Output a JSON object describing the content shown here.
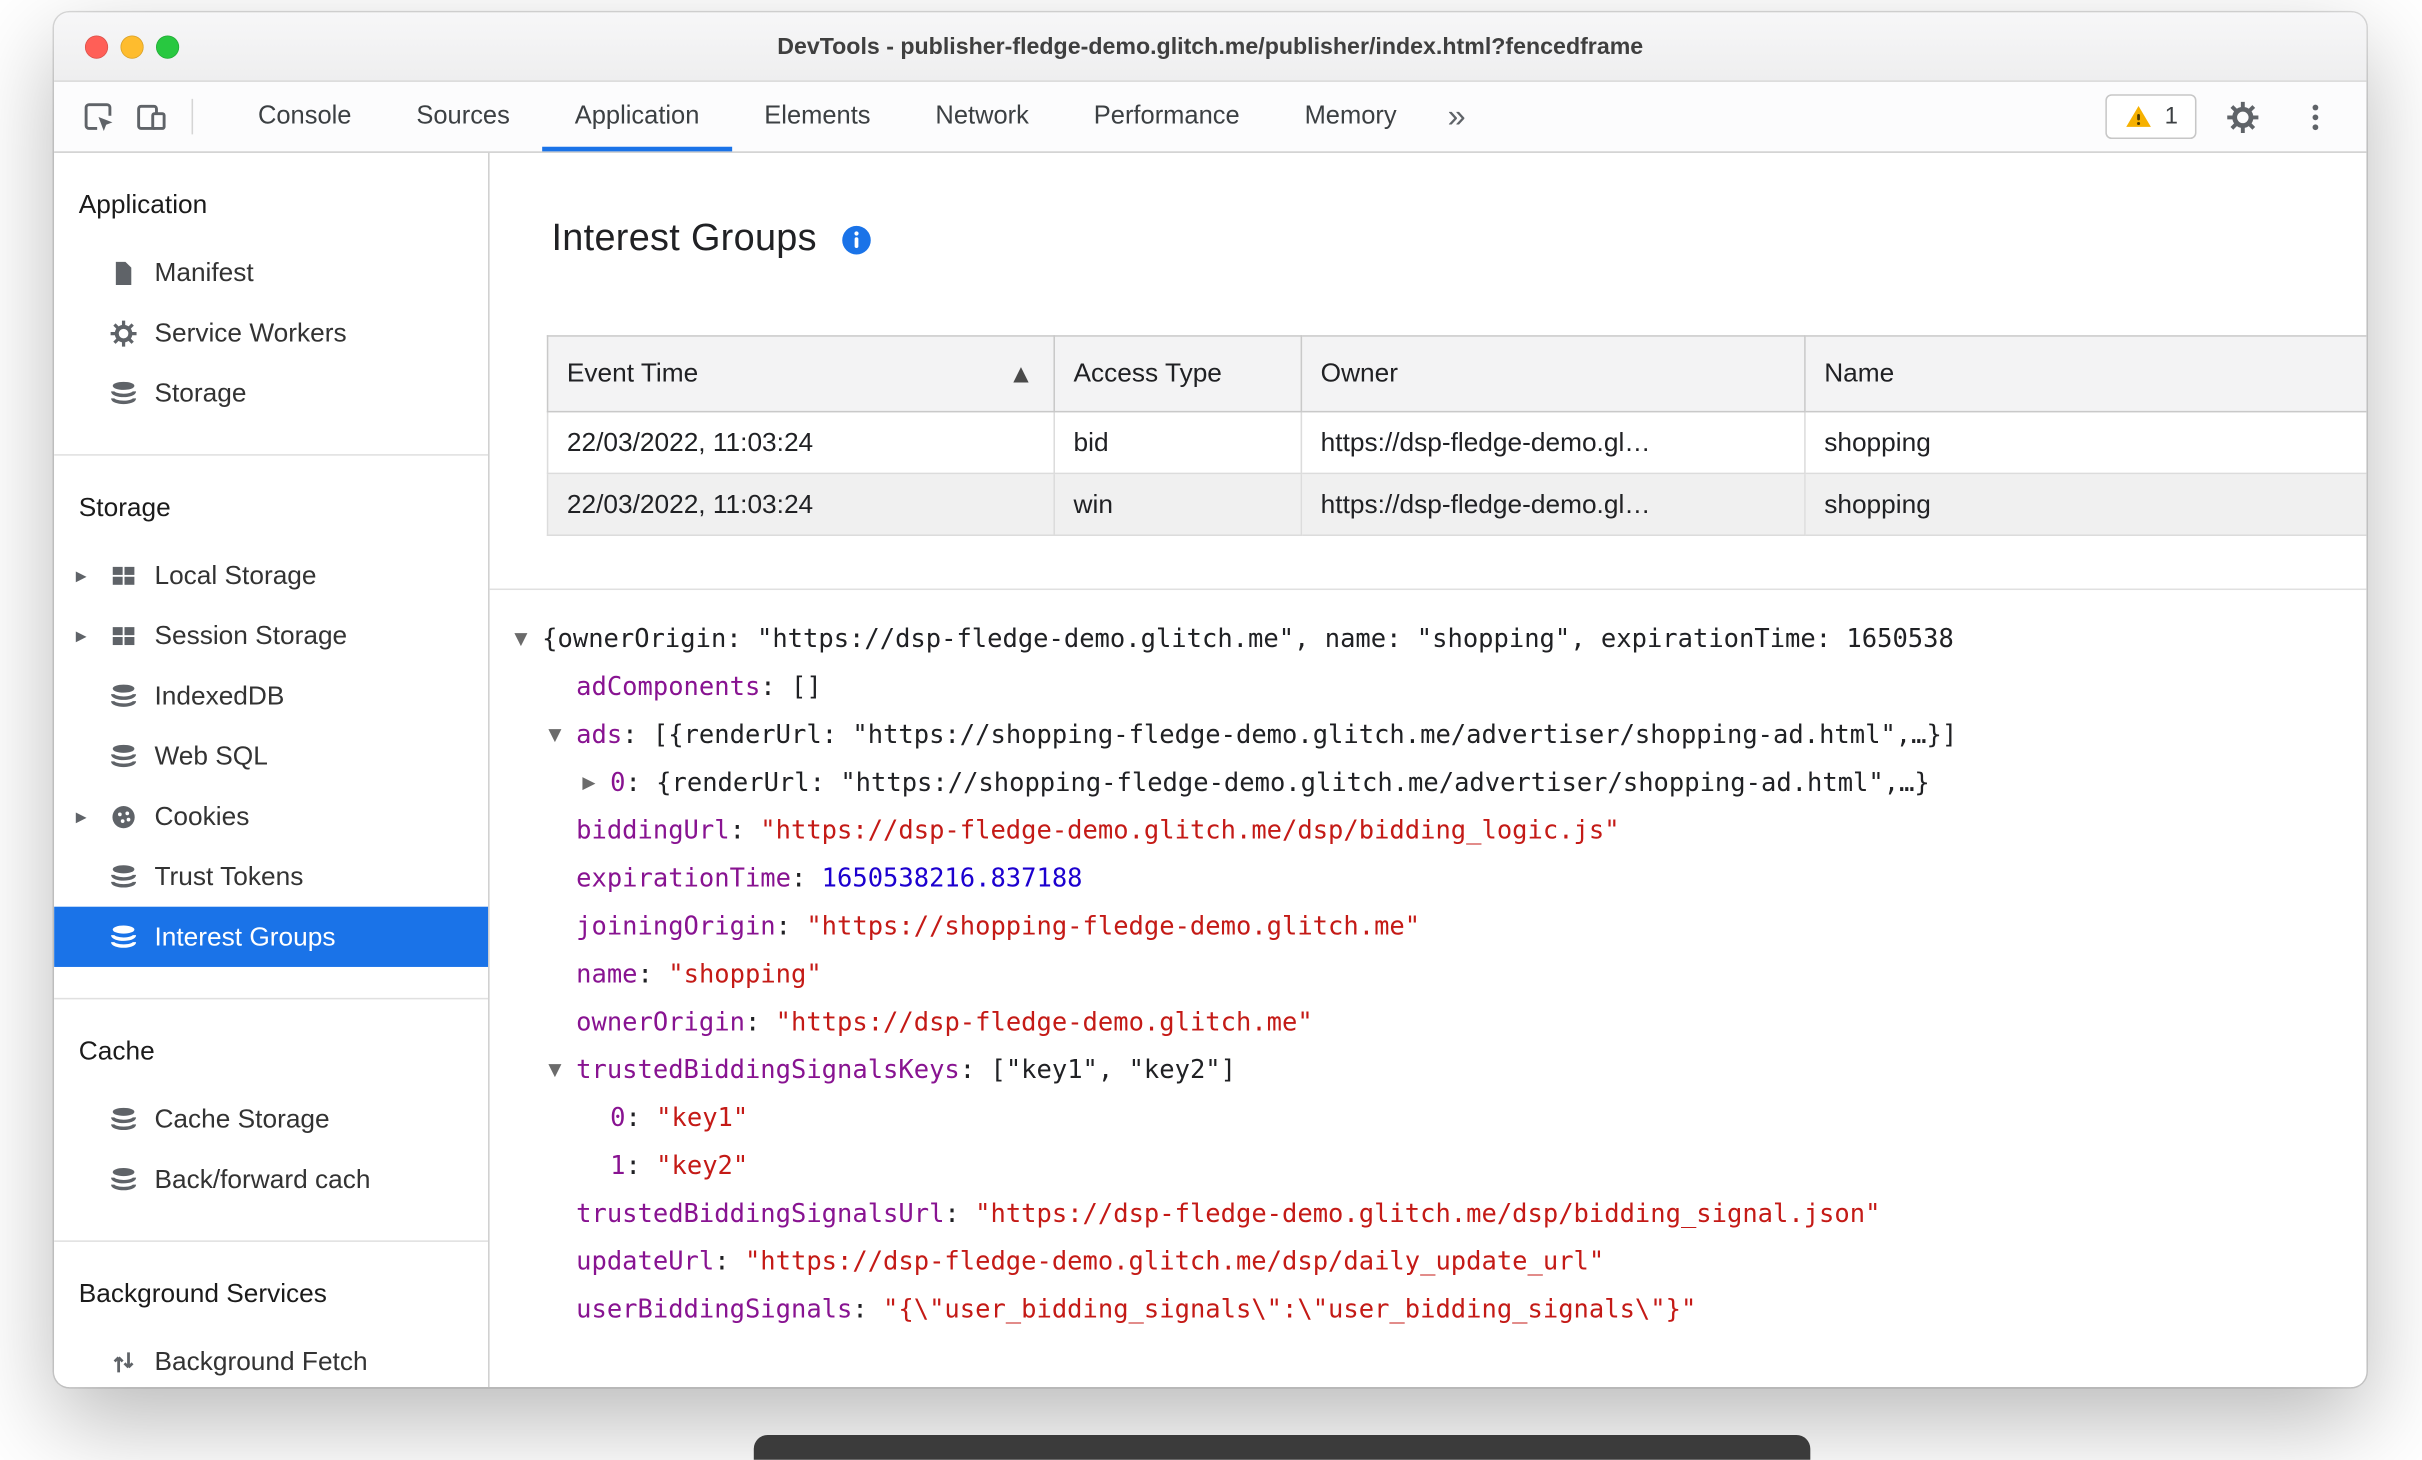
{
  "window": {
    "title": "DevTools - publisher-fledge-demo.glitch.me/publisher/index.html?fencedframe"
  },
  "toolbar": {
    "tabs": [
      {
        "label": "Console",
        "active": false
      },
      {
        "label": "Sources",
        "active": false
      },
      {
        "label": "Application",
        "active": true
      },
      {
        "label": "Elements",
        "active": false
      },
      {
        "label": "Network",
        "active": false
      },
      {
        "label": "Performance",
        "active": false
      },
      {
        "label": "Memory",
        "active": false
      }
    ],
    "more_tabs_glyph": "»",
    "issues_count": "1",
    "icons": {
      "inspect": "inspect-icon",
      "device_toolbar": "device-toolbar-icon",
      "issues": "warning-icon",
      "settings": "gear-icon",
      "more_options": "kebab-menu-icon"
    }
  },
  "sidebar": {
    "sections": [
      {
        "title": "Application",
        "items": [
          {
            "label": "Manifest",
            "icon": "document-icon"
          },
          {
            "label": "Service Workers",
            "icon": "gear-icon"
          },
          {
            "label": "Storage",
            "icon": "database-icon"
          }
        ]
      },
      {
        "title": "Storage",
        "items": [
          {
            "label": "Local Storage",
            "icon": "table-icon",
            "expandable": true
          },
          {
            "label": "Session Storage",
            "icon": "table-icon",
            "expandable": true
          },
          {
            "label": "IndexedDB",
            "icon": "database-icon"
          },
          {
            "label": "Web SQL",
            "icon": "database-icon"
          },
          {
            "label": "Cookies",
            "icon": "cookie-icon",
            "expandable": true
          },
          {
            "label": "Trust Tokens",
            "icon": "database-icon"
          },
          {
            "label": "Interest Groups",
            "icon": "database-icon",
            "selected": true
          }
        ]
      },
      {
        "title": "Cache",
        "items": [
          {
            "label": "Cache Storage",
            "icon": "database-icon"
          },
          {
            "label": "Back/forward cach",
            "icon": "database-icon"
          }
        ]
      },
      {
        "title": "Background Services",
        "items": [
          {
            "label": "Background Fetch",
            "icon": "fetch-icon"
          }
        ]
      }
    ]
  },
  "main": {
    "title": "Interest Groups",
    "info_icon": "info-icon",
    "table": {
      "columns": [
        {
          "label": "Event Time",
          "sort": "asc"
        },
        {
          "label": "Access Type"
        },
        {
          "label": "Owner"
        },
        {
          "label": "Name"
        }
      ],
      "rows": [
        [
          "22/03/2022, 11:03:24",
          "bid",
          "https://dsp-fledge-demo.gl…",
          "shopping"
        ],
        [
          "22/03/2022, 11:03:24",
          "win",
          "https://dsp-fledge-demo.gl…",
          "shopping"
        ]
      ]
    },
    "tree": {
      "lines": [
        {
          "indent": 0,
          "arrow": "expanded",
          "segments": [
            {
              "text": "{ownerOrigin: \"https://dsp-fledge-demo.glitch.me\", name: \"shopping\", expirationTime: 1650538",
              "color": "plain"
            }
          ]
        },
        {
          "indent": 1,
          "arrow": null,
          "segments": [
            {
              "text": "adComponents",
              "color": "key"
            },
            {
              "text": ": ",
              "color": "plain"
            },
            {
              "text": "[]",
              "color": "plain"
            }
          ]
        },
        {
          "indent": 1,
          "arrow": "expanded",
          "segments": [
            {
              "text": "ads",
              "color": "key"
            },
            {
              "text": ": ",
              "color": "plain"
            },
            {
              "text": "[{renderUrl: \"https://shopping-fledge-demo.glitch.me/advertiser/shopping-ad.html\",…}]",
              "color": "plain"
            }
          ]
        },
        {
          "indent": 2,
          "arrow": "collapsed",
          "segments": [
            {
              "text": "0",
              "color": "key"
            },
            {
              "text": ": ",
              "color": "plain"
            },
            {
              "text": "{renderUrl: \"https://shopping-fledge-demo.glitch.me/advertiser/shopping-ad.html\",…}",
              "color": "plain"
            }
          ]
        },
        {
          "indent": 1,
          "arrow": null,
          "segments": [
            {
              "text": "biddingUrl",
              "color": "key"
            },
            {
              "text": ": ",
              "color": "plain"
            },
            {
              "text": "\"https://dsp-fledge-demo.glitch.me/dsp/bidding_logic.js\"",
              "color": "string"
            }
          ]
        },
        {
          "indent": 1,
          "arrow": null,
          "segments": [
            {
              "text": "expirationTime",
              "color": "key"
            },
            {
              "text": ": ",
              "color": "plain"
            },
            {
              "text": "1650538216.837188",
              "color": "number"
            }
          ]
        },
        {
          "indent": 1,
          "arrow": null,
          "segments": [
            {
              "text": "joiningOrigin",
              "color": "key"
            },
            {
              "text": ": ",
              "color": "plain"
            },
            {
              "text": "\"https://shopping-fledge-demo.glitch.me\"",
              "color": "string"
            }
          ]
        },
        {
          "indent": 1,
          "arrow": null,
          "segments": [
            {
              "text": "name",
              "color": "key"
            },
            {
              "text": ": ",
              "color": "plain"
            },
            {
              "text": "\"shopping\"",
              "color": "string"
            }
          ]
        },
        {
          "indent": 1,
          "arrow": null,
          "segments": [
            {
              "text": "ownerOrigin",
              "color": "key"
            },
            {
              "text": ": ",
              "color": "plain"
            },
            {
              "text": "\"https://dsp-fledge-demo.glitch.me\"",
              "color": "string"
            }
          ]
        },
        {
          "indent": 1,
          "arrow": "expanded",
          "segments": [
            {
              "text": "trustedBiddingSignalsKeys",
              "color": "key"
            },
            {
              "text": ": ",
              "color": "plain"
            },
            {
              "text": "[\"key1\", \"key2\"]",
              "color": "plain"
            }
          ]
        },
        {
          "indent": 2,
          "arrow": null,
          "segments": [
            {
              "text": "0",
              "color": "key"
            },
            {
              "text": ": ",
              "color": "plain"
            },
            {
              "text": "\"key1\"",
              "color": "string"
            }
          ]
        },
        {
          "indent": 2,
          "arrow": null,
          "segments": [
            {
              "text": "1",
              "color": "key"
            },
            {
              "text": ": ",
              "color": "plain"
            },
            {
              "text": "\"key2\"",
              "color": "string"
            }
          ]
        },
        {
          "indent": 1,
          "arrow": null,
          "segments": [
            {
              "text": "trustedBiddingSignalsUrl",
              "color": "key"
            },
            {
              "text": ": ",
              "color": "plain"
            },
            {
              "text": "\"https://dsp-fledge-demo.glitch.me/dsp/bidding_signal.json\"",
              "color": "string"
            }
          ]
        },
        {
          "indent": 1,
          "arrow": null,
          "segments": [
            {
              "text": "updateUrl",
              "color": "key"
            },
            {
              "text": ": ",
              "color": "plain"
            },
            {
              "text": "\"https://dsp-fledge-demo.glitch.me/dsp/daily_update_url\"",
              "color": "string"
            }
          ]
        },
        {
          "indent": 1,
          "arrow": null,
          "segments": [
            {
              "text": "userBiddingSignals",
              "color": "key"
            },
            {
              "text": ": ",
              "color": "plain"
            },
            {
              "text": "\"{\\\"user_bidding_signals\\\":\\\"user_bidding_signals\\\"}\"",
              "color": "string"
            }
          ]
        }
      ]
    }
  },
  "glyphs": {
    "sort_asc": "▲",
    "expander": "▸",
    "tree_expanded": "▼",
    "tree_collapsed": "▶"
  },
  "colors": {
    "accent": "#1a73e8",
    "selected_bg": "#1a73e8",
    "key": "#881391",
    "string": "#c41a16",
    "number": "#1c00cf",
    "warning": "#f6b100"
  }
}
